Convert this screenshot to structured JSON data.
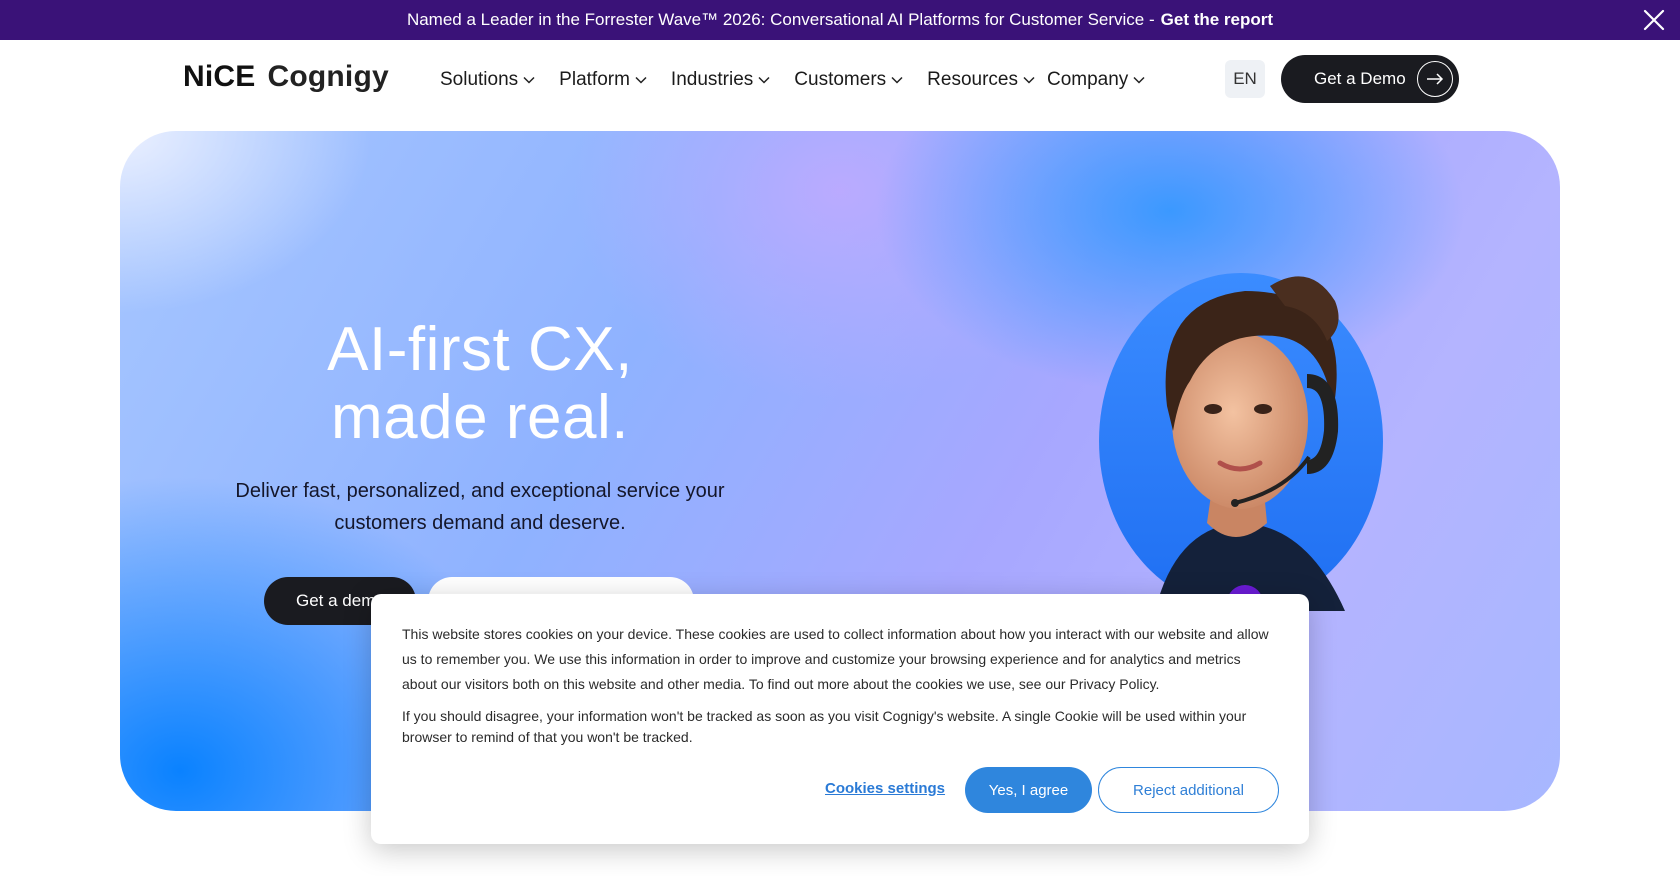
{
  "announcement": {
    "message": "Named a Leader in the Forrester Wave™ 2026: Conversational AI Platforms for Customer Service -",
    "cta": "Get the report"
  },
  "logo": {
    "brand_part1": "NiCE",
    "brand_part2": "Cognigy"
  },
  "nav": {
    "items": [
      {
        "label": "Solutions"
      },
      {
        "label": "Platform"
      },
      {
        "label": "Industries"
      },
      {
        "label": "Customers"
      },
      {
        "label": "Resources"
      },
      {
        "label": "Company"
      }
    ]
  },
  "header": {
    "language": "EN",
    "demo_label": "Get a Demo"
  },
  "hero": {
    "title_line1": "AI-first CX,",
    "title_line2": "made real.",
    "subtitle": "Deliver fast, personalized, and exceptional service your customers demand and deserve.",
    "primary_button": "Get a dem"
  },
  "cookie": {
    "paragraph1": "This website stores cookies on your device. These cookies are used to collect information about how you interact with our website and allow us to remember you. We use this information in order to improve and customize your browsing experience and for analytics and metrics about our visitors both on this website and other media. To find out more about the cookies we use, see our Privacy Policy.",
    "paragraph2": "If you should disagree, your information won't be tracked as soon as you visit Cognigy's website. A single Cookie will be used within your browser to remind of that you won't be tracked.",
    "settings_label": "Cookies settings",
    "agree_label": "Yes, I agree",
    "reject_label": "Reject additional"
  },
  "colors": {
    "announcement_bg": "#3a1278",
    "dark_button": "#1a1b20",
    "cookie_accent": "#2f86dd",
    "hero_blue": "#0a82ff"
  },
  "icons": {
    "close": "close-icon",
    "chevron": "chevron-down-icon",
    "arrow": "arrow-right-icon"
  }
}
